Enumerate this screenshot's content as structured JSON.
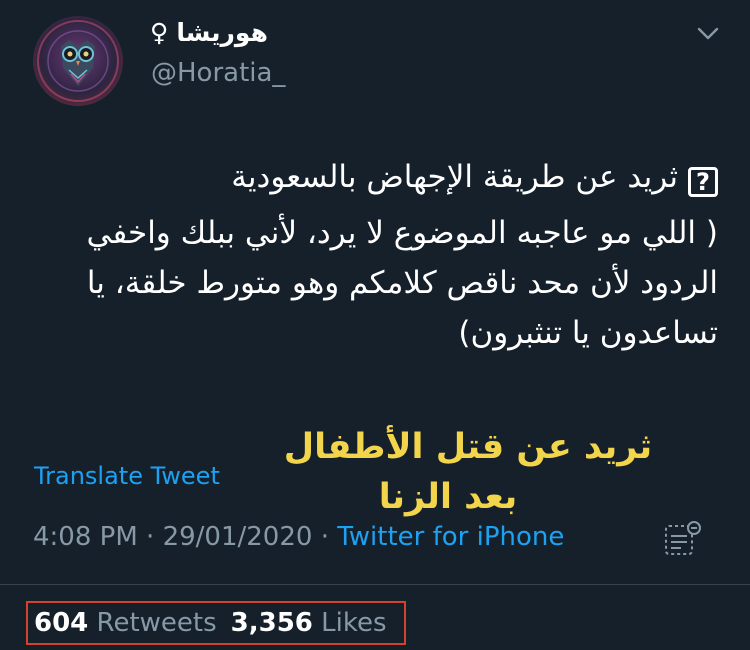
{
  "user": {
    "display_name": "هوريشا",
    "gender_symbol": "♀",
    "handle": "@Horatia_",
    "avatar_icon": "owl-mandala-avatar"
  },
  "tweet": {
    "line1_text": "ثريد عن طريقة الإجهاض بالسعودية",
    "question_symbol": "?",
    "paragraph2": "( اللي مو عاجبه الموضوع لا يرد، لأني ببلك واخفي الردود لأن محد ناقص كلامكم وهو متورط خلقة، يا تساعدون يا تنثبرون)"
  },
  "overlay_caption": {
    "line1": "ثريد عن قتل الأطفال",
    "line2": "بعد الزنا",
    "color": "#f3d54b"
  },
  "translate_link": "Translate Tweet",
  "meta": {
    "time": "4:08 PM",
    "separator": "·",
    "date": "29/01/2020",
    "source": "Twitter for iPhone"
  },
  "stats": {
    "retweets_count": "604",
    "retweets_label": "Retweets",
    "likes_count": "3,356",
    "likes_label": "Likes"
  },
  "colors": {
    "background": "#15202b",
    "secondary_text": "#8899a6",
    "link": "#1da1f2",
    "highlight_box": "#d0442c"
  }
}
